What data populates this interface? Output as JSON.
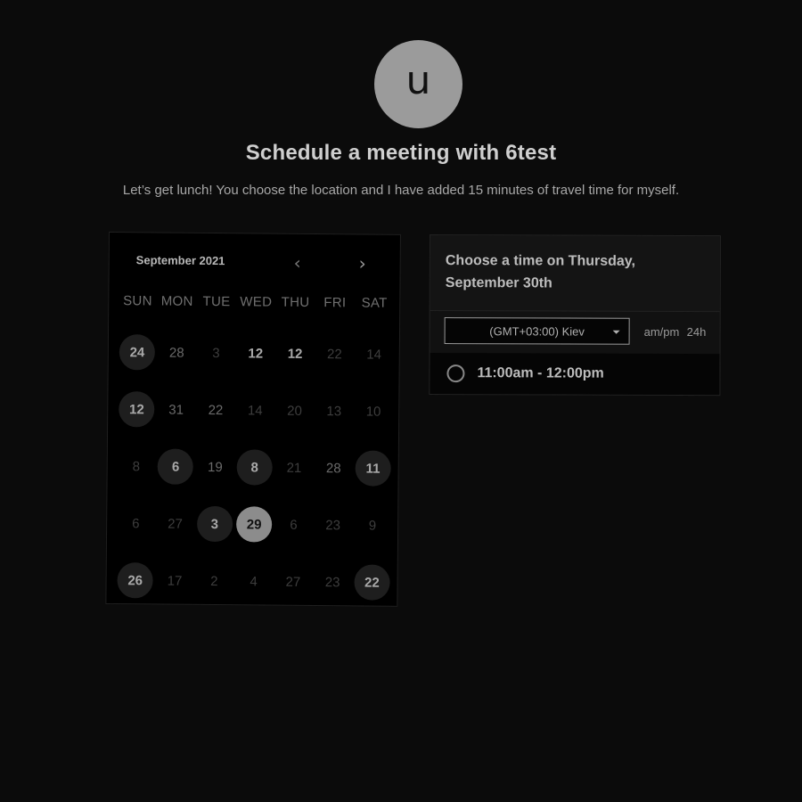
{
  "avatar": {
    "initial": "u"
  },
  "header": {
    "title": "Schedule a meeting with 6test",
    "subtitle": "Let’s get lunch! You choose the location and I have added 15 minutes of travel time for myself."
  },
  "calendar": {
    "month": "September 2021",
    "prev_icon": "chevron-left-icon",
    "next_icon": "chevron-right-icon",
    "weekdays": [
      "SUN",
      "MON",
      "TUE",
      "WED",
      "THU",
      "FRI",
      "SAT"
    ],
    "days": [
      {
        "n": "24",
        "s": "avail"
      },
      {
        "n": "28",
        "s": "mid"
      },
      {
        "n": "3",
        "s": "off"
      },
      {
        "n": "12",
        "s": "bold"
      },
      {
        "n": "12",
        "s": "bold"
      },
      {
        "n": "22",
        "s": "off"
      },
      {
        "n": "14",
        "s": "off"
      },
      {
        "n": "12",
        "s": "avail"
      },
      {
        "n": "31",
        "s": "mid"
      },
      {
        "n": "22",
        "s": "mid"
      },
      {
        "n": "14",
        "s": "off"
      },
      {
        "n": "20",
        "s": "off"
      },
      {
        "n": "13",
        "s": "off"
      },
      {
        "n": "10",
        "s": "off"
      },
      {
        "n": "8",
        "s": "off"
      },
      {
        "n": "6",
        "s": "avail"
      },
      {
        "n": "19",
        "s": "mid"
      },
      {
        "n": "8",
        "s": "avail"
      },
      {
        "n": "21",
        "s": "off"
      },
      {
        "n": "28",
        "s": "mid"
      },
      {
        "n": "11",
        "s": "avail"
      },
      {
        "n": "6",
        "s": "off"
      },
      {
        "n": "27",
        "s": "off"
      },
      {
        "n": "3",
        "s": "avail"
      },
      {
        "n": "29",
        "s": "selected"
      },
      {
        "n": "6",
        "s": "off"
      },
      {
        "n": "23",
        "s": "off"
      },
      {
        "n": "9",
        "s": "off"
      },
      {
        "n": "26",
        "s": "avail"
      },
      {
        "n": "17",
        "s": "off"
      },
      {
        "n": "2",
        "s": "off"
      },
      {
        "n": "4",
        "s": "off"
      },
      {
        "n": "27",
        "s": "off"
      },
      {
        "n": "23",
        "s": "off"
      },
      {
        "n": "22",
        "s": "avail"
      }
    ]
  },
  "panel": {
    "title": "Choose a time on Thursday, September 30th",
    "timezone": "(GMT+03:00) Kiev",
    "format_ampm": "am/pm",
    "format_24h": "24h",
    "slots": [
      "11:00am - 12:00pm"
    ]
  }
}
